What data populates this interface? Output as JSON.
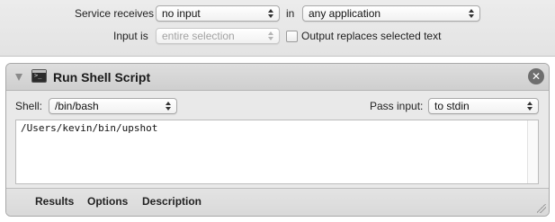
{
  "service": {
    "receives_label": "Service receives",
    "receives_value": "no input",
    "in_label": "in",
    "application_value": "any application",
    "input_is_label": "Input is",
    "input_is_value": "entire selection",
    "output_replaces_label": "Output replaces selected text",
    "output_replaces_checked": false
  },
  "action": {
    "title": "Run Shell Script",
    "shell_label": "Shell:",
    "shell_value": "/bin/bash",
    "pass_input_label": "Pass input:",
    "pass_input_value": "to stdin",
    "script": "/Users/kevin/bin/upshot",
    "tabs": [
      {
        "label": "Results"
      },
      {
        "label": "Options"
      },
      {
        "label": "Description"
      }
    ]
  },
  "icons": {
    "disclosure": "disclosure-triangle-icon",
    "terminal": "terminal-icon",
    "close": "close-icon",
    "close_glyph": "✕"
  }
}
